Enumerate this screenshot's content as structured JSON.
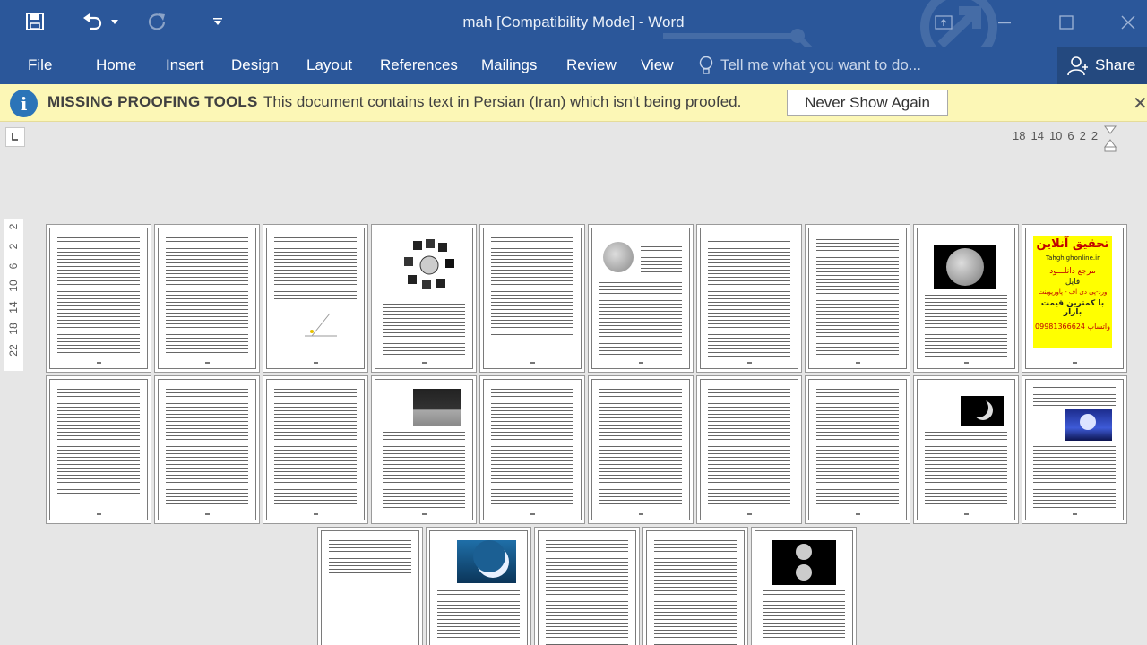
{
  "window": {
    "title": "mah [Compatibility Mode] - Word",
    "minimize": "minimize-icon",
    "maximize": "maximize-icon",
    "close": "close-icon",
    "ribbon_display": "ribbon-display-options-icon"
  },
  "quick_access": {
    "save": "save-icon",
    "undo": "undo-icon",
    "redo": "redo-icon",
    "customize": "customize-qat-icon"
  },
  "ribbon": {
    "tabs": [
      "File",
      "Home",
      "Insert",
      "Design",
      "Layout",
      "References",
      "Mailings",
      "Review",
      "View"
    ],
    "tell_me_placeholder": "Tell me what you want to do...",
    "share_label": "Share"
  },
  "message_bar": {
    "title": "MISSING PROOFING TOOLS",
    "text": "This document contains text in Persian (Iran) which isn't being proofed.",
    "button": "Never Show Again"
  },
  "rulers": {
    "horizontal": [
      "18",
      "14",
      "10",
      "6",
      "2",
      "2"
    ],
    "vertical": [
      "2",
      "2",
      "2",
      "6",
      "10",
      "14",
      "18",
      "22"
    ]
  },
  "pages": {
    "ad_page": {
      "line1": "تحقیق آنلاین",
      "line2": "Tahghighonline.ir",
      "line3": "مرجع دانلـــود",
      "line4": "فایل",
      "line5": "ورد-پی دی اف - پاورپوینت",
      "line6": "با کمترین قیمت بازار",
      "line7": "09981366624 واتساپ"
    }
  },
  "colors": {
    "ribbon_blue": "#2b579a",
    "message_bar": "#fcf7b6",
    "workspace": "#e6e6e6",
    "ad_yellow": "#ffff00"
  }
}
